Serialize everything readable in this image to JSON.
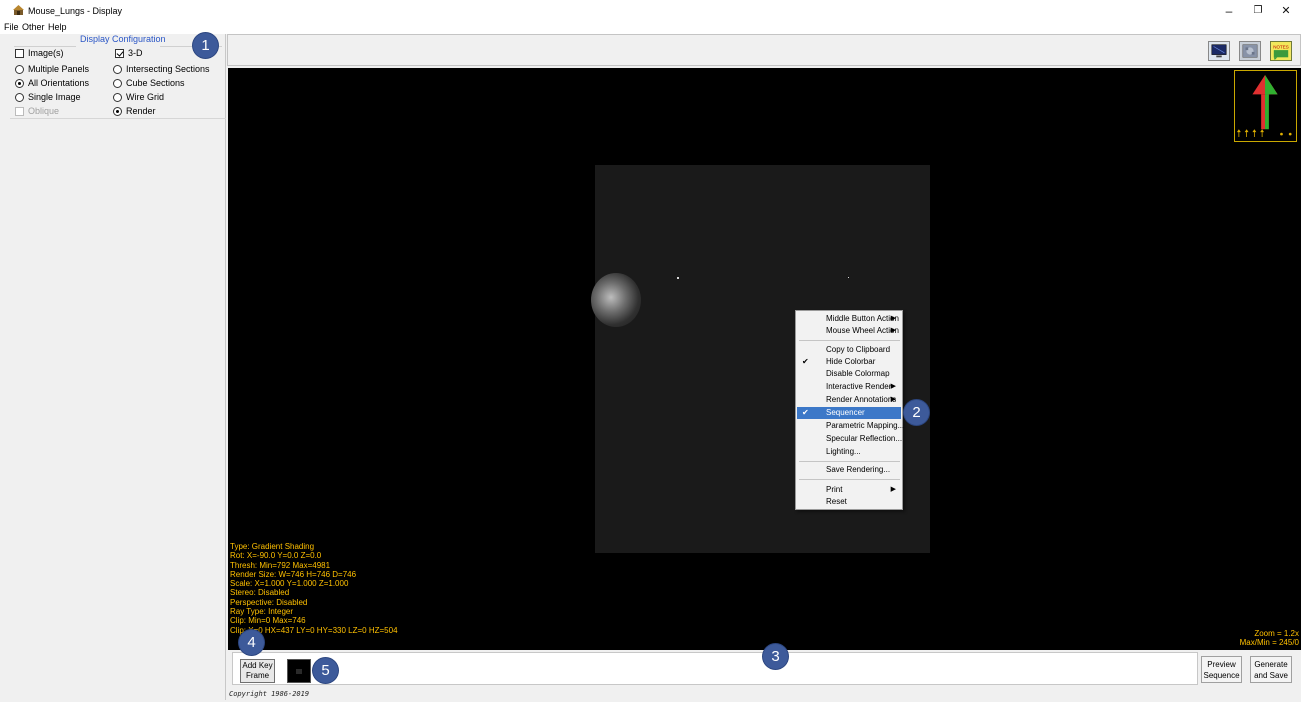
{
  "window": {
    "title": "Mouse_Lungs - Display",
    "minimize": "–",
    "restore": "❐",
    "close": "✕"
  },
  "menu": [
    "File",
    "Other",
    "Help"
  ],
  "display_config": {
    "title": "Display Configuration",
    "images_label": "Image(s)",
    "three_d_label": "3-D",
    "left_options": [
      {
        "label": "Multiple Panels",
        "checked": false
      },
      {
        "label": "All Orientations",
        "checked": true
      },
      {
        "label": "Single Image",
        "checked": false
      }
    ],
    "oblique_label": "Oblique",
    "right_options": [
      {
        "label": "Intersecting Sections",
        "checked": false
      },
      {
        "label": "Cube Sections",
        "checked": false
      },
      {
        "label": "Wire Grid",
        "checked": false
      },
      {
        "label": "Render",
        "checked": true
      }
    ]
  },
  "toolbar": {
    "notes_label": "NOTES"
  },
  "viewport": {
    "info_lines": [
      "Type: Gradient Shading",
      "Rot: X=-90.0 Y=0.0 Z=0.0",
      "Thresh: Min=792 Max=4981",
      "Render Size: W=746 H=746 D=746",
      "Scale: X=1.000 Y=1.000 Z=1.000",
      "Stereo: Disabled",
      "Perspective: Disabled",
      "Ray Type: Integer",
      "Clip: Min=0 Max=746",
      "Clip: X=0 HX=437 LY=0 HY=330 LZ=0 HZ=504"
    ],
    "zoom": "Zoom = 1.2x",
    "maxmin": "Max/Min = 245/0"
  },
  "context_menu": {
    "items": [
      {
        "label": "Middle Button Action",
        "check": false,
        "submenu": true,
        "selected": false
      },
      {
        "label": "Mouse Wheel Action",
        "check": false,
        "submenu": true,
        "selected": false
      },
      {
        "sep": true
      },
      {
        "label": "Copy to Clipboard",
        "check": false,
        "submenu": false,
        "selected": false
      },
      {
        "label": "Hide Colorbar",
        "check": true,
        "submenu": false,
        "selected": false
      },
      {
        "label": "Disable Colormap",
        "check": false,
        "submenu": false,
        "selected": false
      },
      {
        "label": "Interactive Render",
        "check": false,
        "submenu": true,
        "selected": false
      },
      {
        "label": "Render Annotations",
        "check": false,
        "submenu": true,
        "selected": false
      },
      {
        "label": "Sequencer",
        "check": true,
        "submenu": false,
        "selected": true
      },
      {
        "label": "Parametric Mapping...",
        "check": false,
        "submenu": false,
        "selected": false
      },
      {
        "label": "Specular Reflection...",
        "check": false,
        "submenu": false,
        "selected": false
      },
      {
        "label": "Lighting...",
        "check": false,
        "submenu": false,
        "selected": false
      },
      {
        "sep": true
      },
      {
        "label": "Save Rendering...",
        "check": false,
        "submenu": false,
        "selected": false
      },
      {
        "sep": true
      },
      {
        "label": "Print",
        "check": false,
        "submenu": true,
        "selected": false
      },
      {
        "label": "Reset",
        "check": false,
        "submenu": false,
        "selected": false
      }
    ]
  },
  "sequencer": {
    "add_key_frame": "Add Key Frame",
    "preview": "Preview Sequence",
    "generate": "Generate and Save"
  },
  "copyright": "Copyright 1986-2019",
  "callouts": [
    "1",
    "2",
    "3",
    "4",
    "5"
  ],
  "colors": {
    "info_text": "#ffc000",
    "selection": "#3c78c8",
    "callout": "#3d5a9a",
    "heading": "#2a56c6"
  }
}
